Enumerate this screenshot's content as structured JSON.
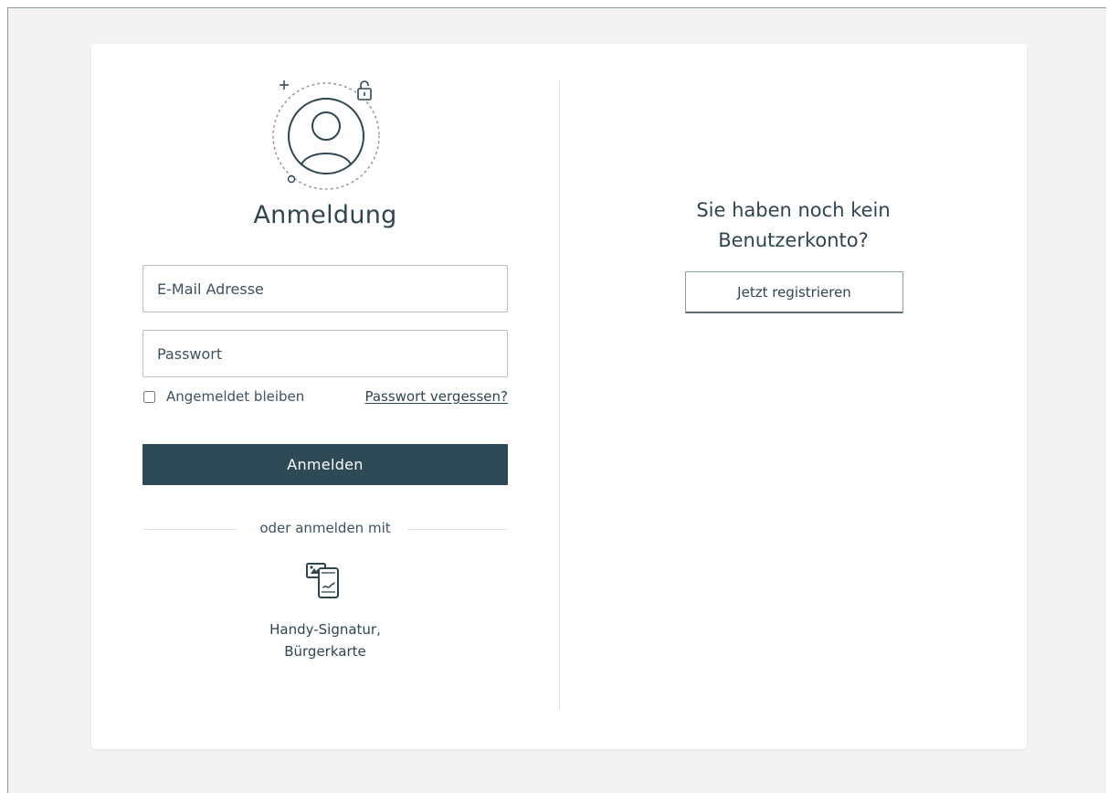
{
  "login": {
    "title": "Anmeldung",
    "email_placeholder": "E-Mail Adresse",
    "password_placeholder": "Passwort",
    "remember_label": "Angemeldet bleiben",
    "forgot_link": "Passwort vergessen?",
    "submit_label": "Anmelden",
    "alt_login_divider": "oder anmelden mit",
    "alt_login_option": {
      "icon": "mobile-signature-icon",
      "line1": "Handy-Signatur,",
      "line2": "Bürgerkarte"
    }
  },
  "register": {
    "question_line1": "Sie haben noch kein",
    "question_line2": "Benutzerkonto?",
    "button_label": "Jetzt registrieren"
  },
  "icons": {
    "avatar": "user-avatar-icon",
    "lock": "lock-icon",
    "plus": "plus-icon"
  },
  "colors": {
    "primary": "#2f4a57",
    "text": "#2f4550",
    "border": "#b8c1c6",
    "background": "#f3f3f3"
  }
}
